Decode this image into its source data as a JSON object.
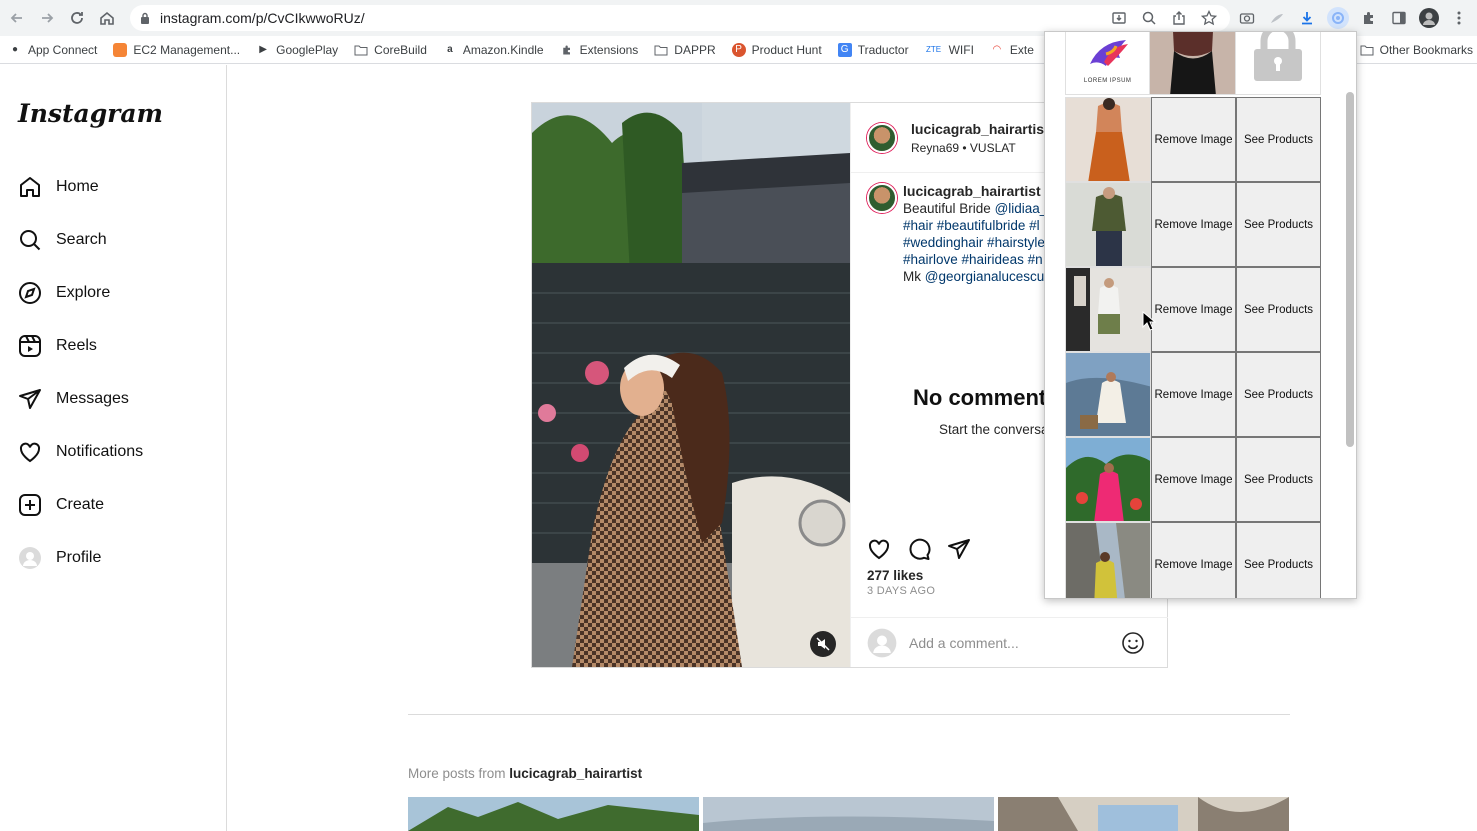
{
  "browser": {
    "url": "instagram.com/p/CvCIkwwoRUz/",
    "bookmarks": [
      "App Connect",
      "EC2 Management...",
      "GooglePlay",
      "CoreBuild",
      "Amazon.Kindle",
      "Extensions",
      "DAPPR",
      "Product Hunt",
      "Traductor",
      "WIFI",
      "Exte"
    ],
    "other_bookmarks": "Other Bookmarks"
  },
  "instagram": {
    "logo": "Instagram",
    "nav": [
      "Home",
      "Search",
      "Explore",
      "Reels",
      "Messages",
      "Notifications",
      "Create",
      "Profile"
    ],
    "post": {
      "username": "lucicagrab_hairartist",
      "subtitle": "Reyna69 • VUSLAT",
      "caption_user": "lucicagrab_hairartist",
      "caption_line1_text": "Beautiful Bride ",
      "caption_line1_mention": "@lidiaa_",
      "caption_line2": "#hair #beautifulbride #l",
      "caption_line3": "#weddinghair #hairstyle",
      "caption_line4": "#hairlove #hairideas #n",
      "caption_line5_text": "Mk ",
      "caption_line5_mention": "@georgianalucescu",
      "no_comments": "No comment",
      "start_conversation": "Start the conversa",
      "likes": "277 likes",
      "time_ago": "3 DAYS AGO",
      "comment_placeholder": "Add a comment..."
    },
    "more_posts_prefix": "More posts from ",
    "more_posts_user": "lucicagrab_hairartist"
  },
  "extension_popup": {
    "logo_text": "LOREM IPSUM",
    "rows": [
      {
        "remove": "Remove Image",
        "see": "See Products"
      },
      {
        "remove": "Remove Image",
        "see": "See Products"
      },
      {
        "remove": "Remove Image",
        "see": "See Products"
      },
      {
        "remove": "Remove Image",
        "see": "See Products"
      },
      {
        "remove": "Remove Image",
        "see": "See Products"
      },
      {
        "remove": "Remove Image",
        "see": "See Products"
      }
    ]
  }
}
